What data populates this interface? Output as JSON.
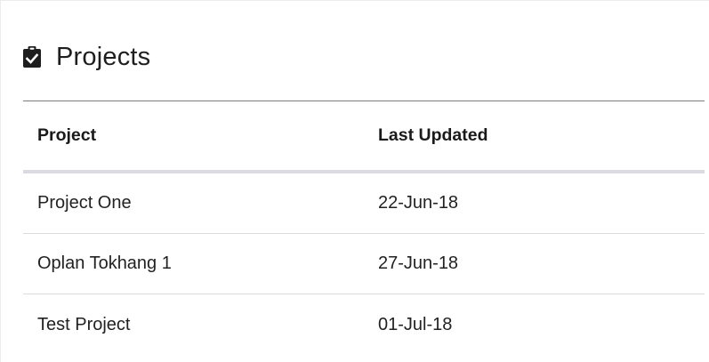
{
  "header": {
    "icon": "clipboard-check-icon",
    "title": "Projects"
  },
  "table": {
    "columns": [
      "Project",
      "Last Updated"
    ],
    "rows": [
      [
        "Project One",
        "22-Jun-18"
      ],
      [
        "Oplan Tokhang 1",
        "27-Jun-18"
      ],
      [
        "Test Project",
        "01-Jul-18"
      ]
    ]
  },
  "colors": {
    "header_rule": "#7a7a7a",
    "row_divider": "#dcdcdc",
    "head_divider": "#dadae0"
  }
}
